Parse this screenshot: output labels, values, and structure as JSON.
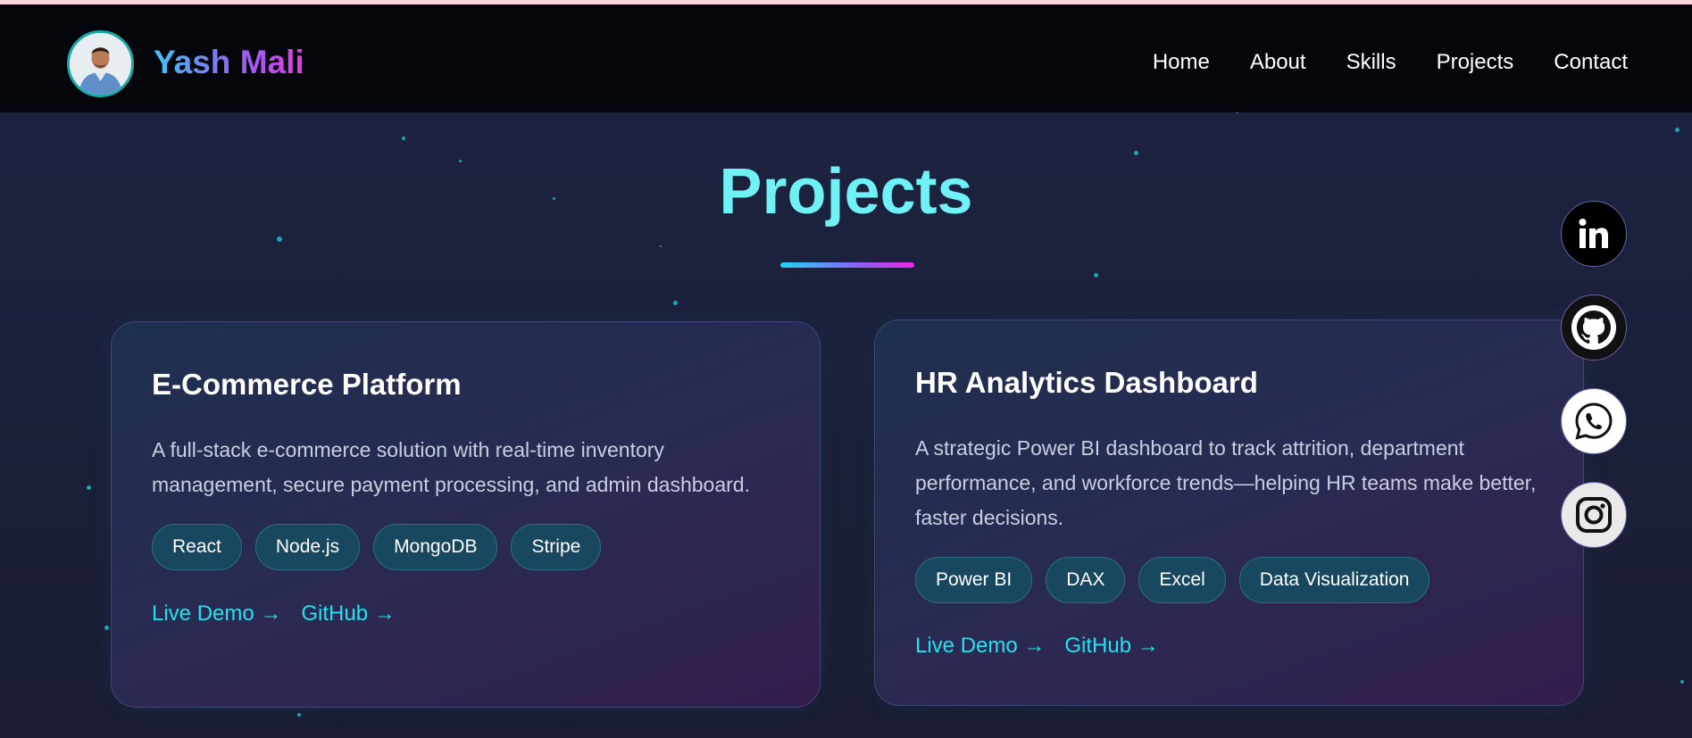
{
  "header": {
    "brand_first": "Yash",
    "brand_last": "Mali",
    "avatar_icon": "profile-photo",
    "nav": [
      "Home",
      "About",
      "Skills",
      "Projects",
      "Contact"
    ]
  },
  "main": {
    "title": "Projects",
    "projects": [
      {
        "title": "E-Commerce Platform",
        "description": "A full-stack e-commerce solution with real-time inventory management, secure payment processing, and admin dashboard.",
        "tags": [
          "React",
          "Node.js",
          "MongoDB",
          "Stripe"
        ],
        "links": [
          "Live Demo →",
          "GitHub →"
        ]
      },
      {
        "title": "HR Analytics Dashboard",
        "description": "A strategic Power BI dashboard to track attrition, department performance, and workforce trends—helping HR teams make better, faster decisions.",
        "tags": [
          "Power BI",
          "DAX",
          "Excel",
          "Data Visualization"
        ],
        "links": [
          "Live Demo →",
          "GitHub →"
        ]
      }
    ]
  },
  "social": {
    "icons": [
      "linkedin-icon",
      "github-icon",
      "whatsapp-icon",
      "instagram-icon"
    ]
  },
  "colors": {
    "accent_cyan": "#21e3f0",
    "title_cyan": "#6ef2f5",
    "gradient_purple": "#8f63f6",
    "gradient_pink": "#e639e8",
    "tag_bg": "#184860"
  }
}
